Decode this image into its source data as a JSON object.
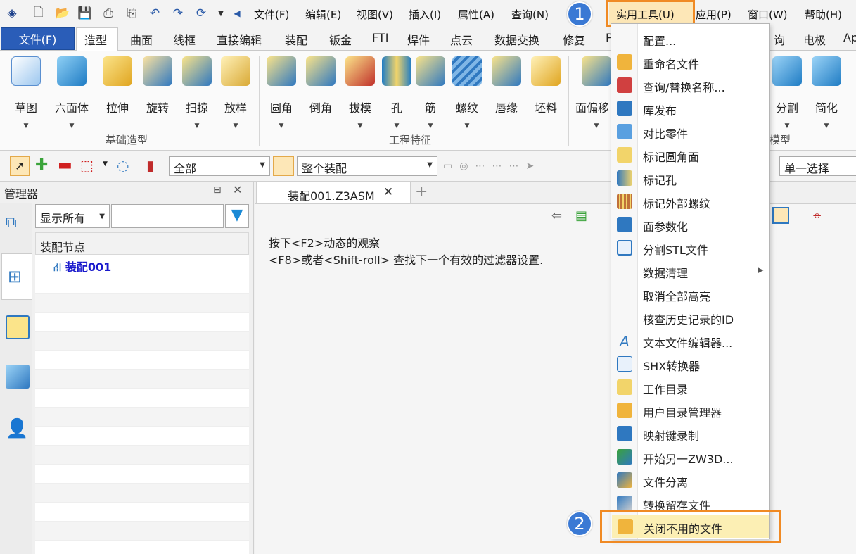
{
  "menubar": {
    "items": [
      "文件(F)",
      "编辑(E)",
      "视图(V)",
      "插入(I)",
      "属性(A)",
      "查询(N)",
      "实用工具(U)",
      "应用(P)",
      "窗口(W)",
      "帮助(H)"
    ]
  },
  "ribbon_tabs": [
    "文件(F)",
    "造型",
    "曲面",
    "线框",
    "直接编辑",
    "装配",
    "钣金",
    "FTI",
    "焊件",
    "点云",
    "数据交换",
    "修复",
    "P",
    "询",
    "电极",
    "Ap"
  ],
  "ribbon": {
    "tools": [
      "草图",
      "六面体",
      "拉伸",
      "旋转",
      "扫掠",
      "放样",
      "圆角",
      "倒角",
      "拔模",
      "孔",
      "筋",
      "螺纹",
      "唇缘",
      "坯料",
      "面偏移",
      "分割",
      "简化"
    ],
    "groups": [
      "基础造型",
      "工程特征",
      "编辑模型"
    ]
  },
  "toolbar2": {
    "filter_value": "全部",
    "assembly_scope": "整个装配",
    "select_mode": "单一选择"
  },
  "manager": {
    "title": "管理器",
    "filter_value": "显示所有",
    "column_header": "装配节点",
    "root_node": "装配001"
  },
  "document": {
    "tab_title": "装配001.Z3ASM",
    "hint_line1": "按下<F2>动态的观察",
    "hint_line2": "<F8>或者<Shift-roll> 查找下一个有效的过滤器设置."
  },
  "dropdown": {
    "items": [
      "配置...",
      "重命名文件",
      "查询/替换名称...",
      "库发布",
      "对比零件",
      "标记圆角面",
      "标记孔",
      "标记外部螺纹",
      "面参数化",
      "分割STL文件",
      "数据清理",
      "取消全部高亮",
      "核查历史记录的ID",
      "文本文件编辑器...",
      "SHX转换器",
      "工作目录",
      "用户目录管理器",
      "映射键录制",
      "开始另一ZW3D...",
      "文件分离",
      "转换留存文件",
      "关闭不用的文件"
    ]
  },
  "badges": [
    "1",
    "2"
  ],
  "colors": {
    "accent": "#2a5db8",
    "highlight": "#f08a24",
    "badge": "#3a79d4",
    "tree_root": "#1a1acc"
  }
}
